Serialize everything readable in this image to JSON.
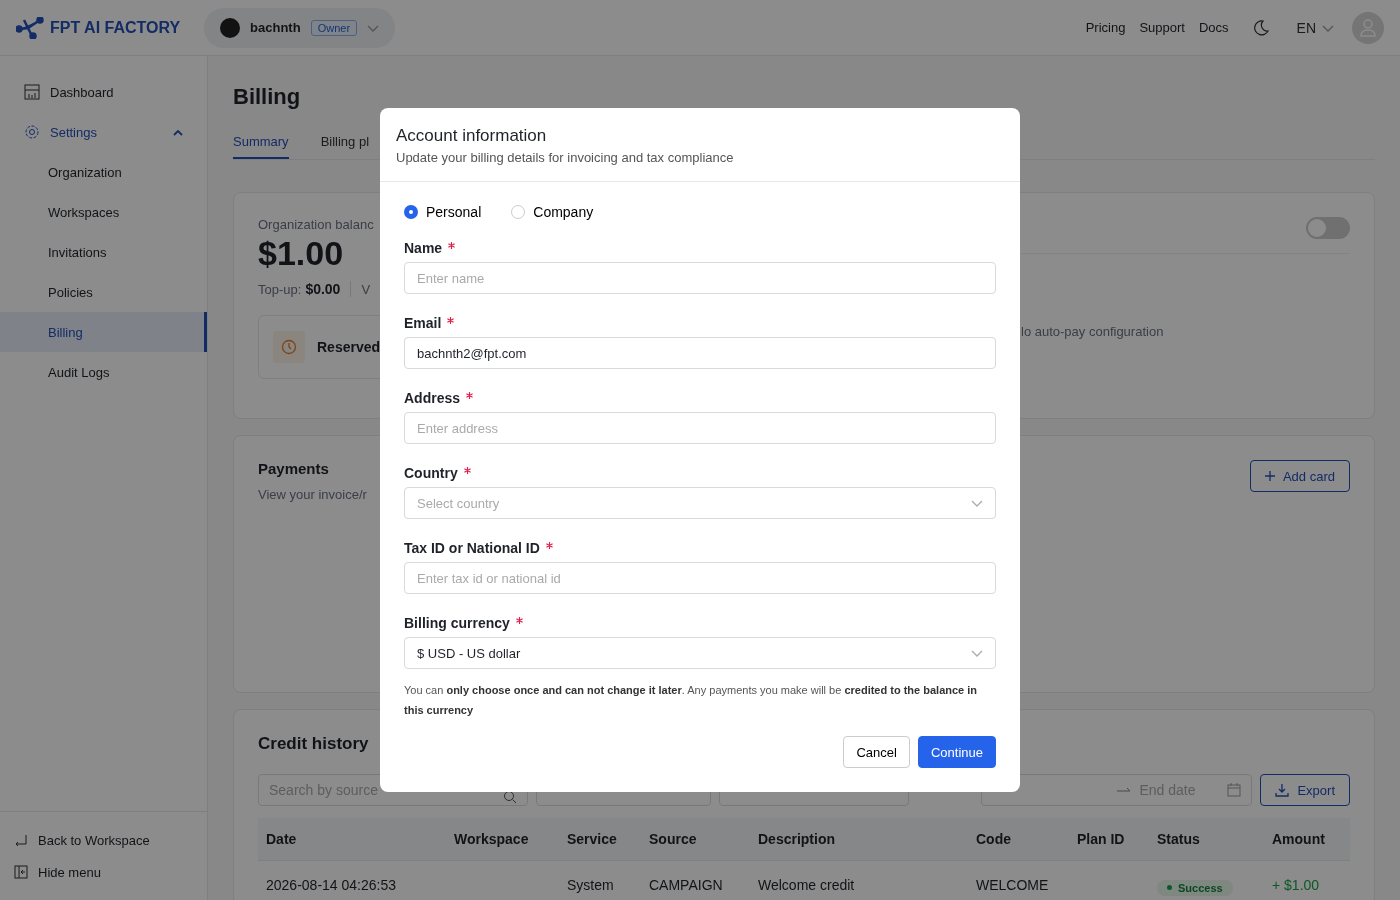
{
  "header": {
    "logo_text": "FPT AI FACTORY",
    "org": {
      "name": "bachnth",
      "badge": "Owner"
    },
    "nav": [
      "Pricing",
      "Support",
      "Docs"
    ],
    "language": "EN"
  },
  "sidebar": {
    "items": [
      {
        "label": "Dashboard",
        "selected": false
      },
      {
        "label": "Settings",
        "selected": true,
        "expanded": true,
        "children": [
          {
            "label": "Organization",
            "selected": false
          },
          {
            "label": "Workspaces",
            "selected": false
          },
          {
            "label": "Invitations",
            "selected": false
          },
          {
            "label": "Policies",
            "selected": false
          },
          {
            "label": "Billing",
            "selected": true
          },
          {
            "label": "Audit Logs",
            "selected": false
          }
        ]
      }
    ],
    "footer": [
      {
        "label": "Back to Workspace"
      },
      {
        "label": "Hide menu"
      }
    ]
  },
  "page": {
    "title": "Billing",
    "tabs": [
      {
        "label": "Summary",
        "selected": true
      },
      {
        "label": "Billing pl",
        "selected": false
      }
    ]
  },
  "balance_card": {
    "label": "Organization balanc",
    "amount": "$1.00",
    "topup_label": "Top-up:",
    "topup_value": "$0.00",
    "cut_text": "V",
    "reserved": "Reserved",
    "autopay_toggle": {
      "on": false
    },
    "autopay_note": "lo auto-pay configuration"
  },
  "payments": {
    "title": "Payments",
    "subtitle": "View your invoice/r",
    "add_button": "Add card"
  },
  "credit_history": {
    "title": "Credit history",
    "search": {
      "placeholder": "Search by source"
    },
    "end_date": {
      "placeholder": "End date"
    },
    "export_button": "Export",
    "columns": [
      "Date",
      "Workspace",
      "Service",
      "Source",
      "Description",
      "Code",
      "Plan ID",
      "Status",
      "Amount"
    ],
    "rows": [
      {
        "date": "2026-08-14 04:26:53",
        "service": "System",
        "source": "CAMPAIGN",
        "description": "Welcome credit",
        "code": "WELCOME",
        "status": "Success",
        "amount": "+ $1.00"
      }
    ]
  },
  "modal": {
    "title": "Account information",
    "subtitle": "Update your billing details for invoicing and tax compliance",
    "account_types": [
      {
        "label": "Personal",
        "selected": true
      },
      {
        "label": "Company",
        "selected": false
      }
    ],
    "fields": [
      {
        "kind": "text",
        "label": "Name",
        "required": true,
        "placeholder": "Enter name"
      },
      {
        "kind": "text",
        "label": "Email",
        "required": true,
        "value": "bachnth2@fpt.com"
      },
      {
        "kind": "text",
        "label": "Address",
        "required": true,
        "placeholder": "Enter address"
      },
      {
        "kind": "select",
        "label": "Country",
        "required": true,
        "placeholder": "Select country"
      },
      {
        "kind": "text",
        "label": "Tax ID or National ID",
        "required": true,
        "placeholder": "Enter tax id or national id"
      },
      {
        "kind": "select",
        "label": "Billing currency",
        "required": true,
        "value": "$ USD - US dollar"
      }
    ],
    "note": "You can **only choose once and can not change it later**. Any payments you make will be **credited to the balance in this currency**",
    "buttons": [
      {
        "label": "Cancel",
        "kind": "secondary"
      },
      {
        "label": "Continue",
        "kind": "primary"
      }
    ]
  }
}
